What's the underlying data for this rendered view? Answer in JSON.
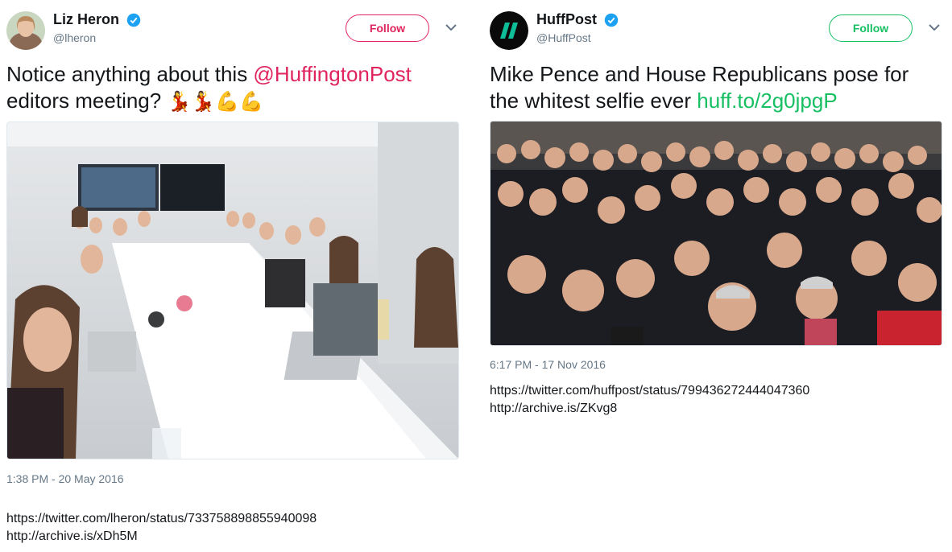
{
  "left_tweet": {
    "author_name": "Liz Heron",
    "author_handle": "@lheron",
    "follow_label": "Follow",
    "text_prefix": "Notice anything about this ",
    "mention": "@HuffingtonPost",
    "text_line2": "editors meeting?",
    "emojis": [
      "💃",
      "💃",
      "💪",
      "💪"
    ],
    "timestamp": "1:38 PM - 20 May 2016",
    "urls": [
      "https://twitter.com/lheron/status/733758898855940098",
      "http://archive.is/xDh5M"
    ],
    "accent_color": "#e0245e"
  },
  "right_tweet": {
    "author_name": "HuffPost",
    "author_handle": "@HuffPost",
    "follow_label": "Follow",
    "text_line1": "Mike Pence and House Republicans pose for",
    "text_line2_prefix": "the whitest selfie ever ",
    "link": "huff.to/2g0jpgP",
    "timestamp": "6:17 PM - 17 Nov 2016",
    "urls": [
      "https://twitter.com/huffpost/status/799436272444047360",
      "http://archive.is/ZKvg8"
    ],
    "accent_color": "#17bf63"
  },
  "icons": {
    "verified": "verified-badge-icon",
    "chevron": "chevron-down-icon"
  }
}
